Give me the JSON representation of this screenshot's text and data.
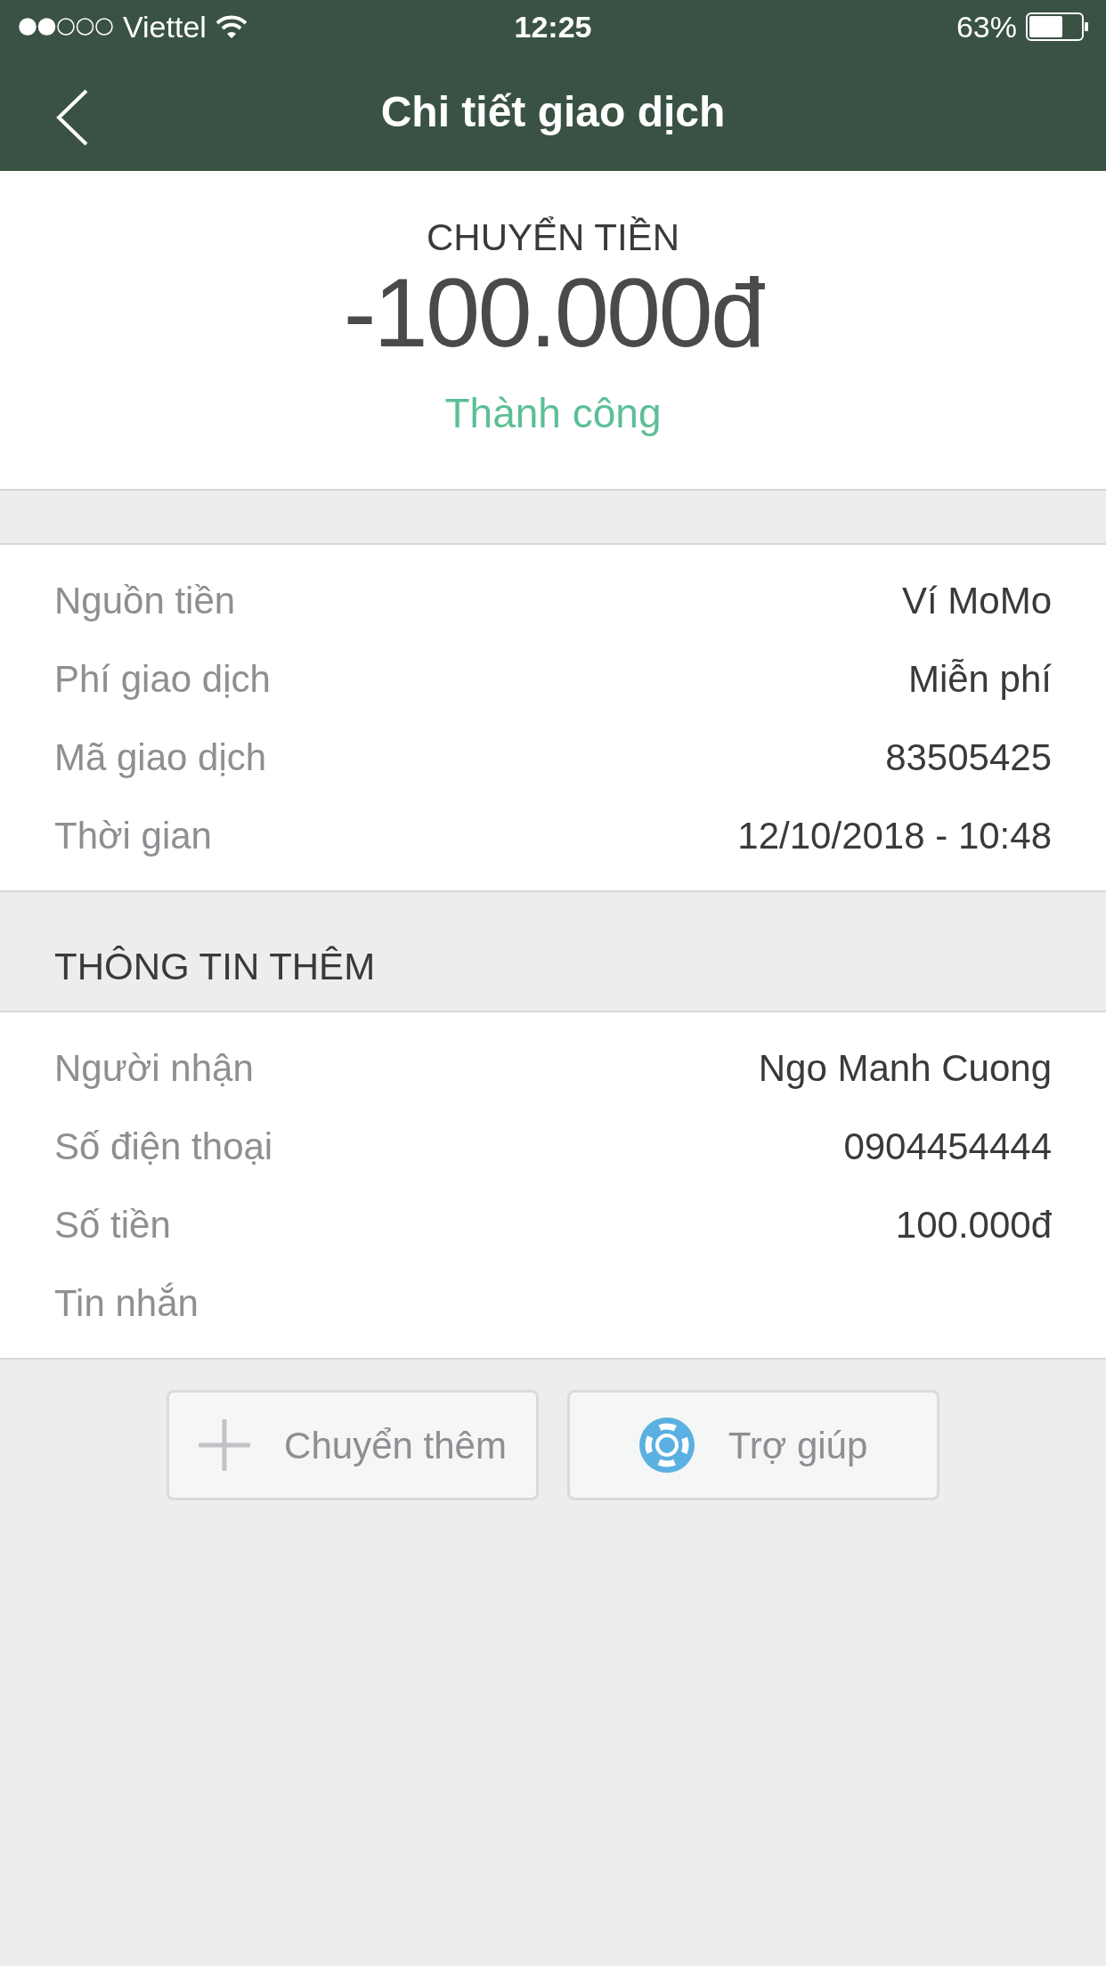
{
  "status_bar": {
    "carrier": "Viettel",
    "time": "12:25",
    "battery": "63%"
  },
  "nav": {
    "title": "Chi tiết giao dịch"
  },
  "summary": {
    "type": "CHUYỂN TIỀN",
    "amount": "-100.000đ",
    "status": "Thành công"
  },
  "details": [
    {
      "label": "Nguồn tiền",
      "value": "Ví MoMo"
    },
    {
      "label": "Phí giao dịch",
      "value": "Miễn phí"
    },
    {
      "label": "Mã giao dịch",
      "value": "83505425"
    },
    {
      "label": "Thời gian",
      "value": "12/10/2018 - 10:48"
    }
  ],
  "extra": {
    "title": "THÔNG TIN THÊM",
    "rows": [
      {
        "label": "Người nhận",
        "value": "Ngo Manh Cuong"
      },
      {
        "label": "Số điện thoại",
        "value": "0904454444"
      },
      {
        "label": "Số tiền",
        "value": "100.000đ"
      },
      {
        "label": "Tin nhắn"
      }
    ]
  },
  "buttons": [
    {
      "kind": "add",
      "label": "Chuyển thêm"
    },
    {
      "kind": "help",
      "label": "Trợ giúp"
    }
  ]
}
